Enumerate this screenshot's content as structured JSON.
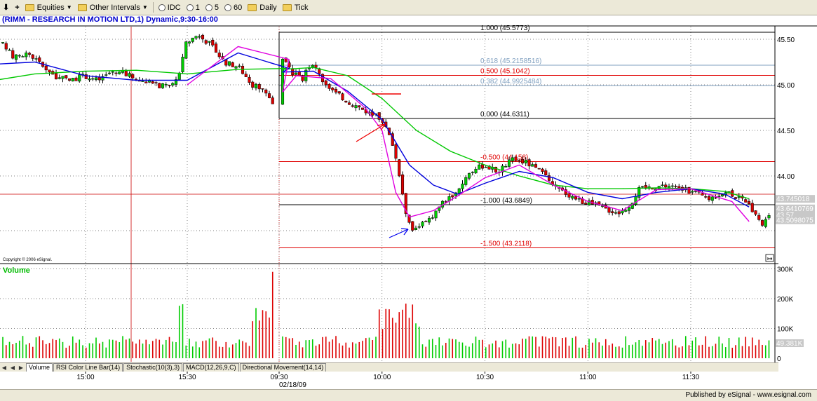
{
  "toolbar": {
    "equities_label": "Equities",
    "other_intervals_label": "Other Intervals",
    "intervals": [
      "IDC",
      "1",
      "5",
      "60",
      "Daily",
      "Tick"
    ]
  },
  "chart_header": "(RIMM - RESEARCH IN MOTION LTD,1) Dynamic,9:30-16:00",
  "copyright": "Copyright © 2006 eSignal.",
  "volume_label": "Volume",
  "footer_text": "Published by eSignal - www.esignal.com",
  "colors": {
    "up": "#00cc00",
    "down": "#dd0000",
    "ma_fast": "#e000e0",
    "ma_mid": "#0000dd",
    "ma_slow": "#00c800",
    "fib_black": "#000000",
    "fib_red": "#e00000",
    "fib_blue": "#7f9fbf",
    "grid": "#555555",
    "arrow_red": "#ee0000",
    "arrow_blue": "#0000ee"
  },
  "tabs": [
    "Volume",
    "RSI Color Line Bar(14)",
    "Stochastic(10(3),3)",
    "MACD(12,26,9,C)",
    "Directional Movement(14,14)"
  ],
  "chart_data": [
    {
      "type": "candlestick",
      "title": "(RIMM - RESEARCH IN MOTION LTD,1) Dynamic,9:30-16:00",
      "price_axis": {
        "ylim": [
          43.2,
          45.75
        ],
        "ticks": [
          45.5,
          45.0,
          44.5,
          44.0
        ],
        "tick_labels": [
          "45.50",
          "45.00",
          "44.50",
          "44.00"
        ]
      },
      "time_axis": {
        "tick_labels": [
          "15:00",
          "15:30",
          "09:30",
          "10:00",
          "10:30",
          "11:00",
          "11:30"
        ],
        "date_label": "02/18/09"
      },
      "grid": true,
      "fib_levels": [
        {
          "label": "1.000 (45.5773)",
          "value": 45.5773,
          "color": "black"
        },
        {
          "label": "0.618 (45.2158516)",
          "value": 45.2158516,
          "color": "blue"
        },
        {
          "label": "0.500 (45.1042)",
          "value": 45.1042,
          "color": "red"
        },
        {
          "label": "0.382 (44.9925484)",
          "value": 44.9925484,
          "color": "blue"
        },
        {
          "label": "0.000 (44.6311)",
          "value": 44.6311,
          "color": "black"
        },
        {
          "label": "-0.500 (44.158)",
          "value": 44.158,
          "color": "red"
        },
        {
          "label": "-1.000 (43.6849)",
          "value": 43.6849,
          "color": "black"
        },
        {
          "label": "-1.500 (43.2118)",
          "value": 43.2118,
          "color": "red"
        }
      ],
      "horizontal_line": 43.8,
      "price_labels": [
        "43.745018",
        "43.6410769",
        "43.57",
        "43.5098075"
      ],
      "ma_fast": [
        [
          "15:30",
          45.0
        ],
        [
          "15:45",
          45.42
        ],
        [
          "16:00",
          45.28
        ],
        [
          "09:31",
          44.92
        ],
        [
          "09:35",
          45.1
        ],
        [
          "09:45",
          45.07
        ],
        [
          "09:55",
          44.75
        ],
        [
          "10:00",
          44.5
        ],
        [
          "10:04",
          43.82
        ],
        [
          "10:08",
          43.55
        ],
        [
          "10:15",
          43.62
        ],
        [
          "10:22",
          43.78
        ],
        [
          "10:30",
          43.98
        ],
        [
          "10:40",
          44.12
        ],
        [
          "10:50",
          43.9
        ],
        [
          "11:00",
          43.72
        ],
        [
          "11:10",
          43.62
        ],
        [
          "11:20",
          43.85
        ],
        [
          "11:30",
          43.86
        ],
        [
          "11:35",
          43.8
        ],
        [
          "11:42",
          43.72
        ],
        [
          "11:47",
          43.5
        ]
      ],
      "ma_mid": [
        [
          "14:30",
          45.22
        ],
        [
          "14:45",
          45.25
        ],
        [
          "15:00",
          45.1
        ],
        [
          "15:15",
          45.05
        ],
        [
          "15:30",
          45.05
        ],
        [
          "15:45",
          45.35
        ],
        [
          "16:00",
          45.18
        ],
        [
          "09:31",
          45.14
        ],
        [
          "09:40",
          45.15
        ],
        [
          "09:50",
          44.93
        ],
        [
          "10:00",
          44.62
        ],
        [
          "10:08",
          44.12
        ],
        [
          "10:15",
          43.9
        ],
        [
          "10:22",
          43.8
        ],
        [
          "10:30",
          43.92
        ],
        [
          "10:40",
          44.05
        ],
        [
          "10:50",
          43.98
        ],
        [
          "11:00",
          43.82
        ],
        [
          "11:10",
          43.75
        ],
        [
          "11:20",
          43.82
        ],
        [
          "11:30",
          43.86
        ],
        [
          "11:40",
          43.8
        ],
        [
          "11:47",
          43.66
        ]
      ],
      "ma_slow": [
        [
          "14:30",
          45.03
        ],
        [
          "14:45",
          45.12
        ],
        [
          "15:00",
          45.15
        ],
        [
          "15:15",
          45.16
        ],
        [
          "15:30",
          45.12
        ],
        [
          "15:45",
          45.17
        ],
        [
          "16:00",
          45.18
        ],
        [
          "09:31",
          45.17
        ],
        [
          "09:40",
          45.19
        ],
        [
          "09:50",
          45.1
        ],
        [
          "10:00",
          44.85
        ],
        [
          "10:10",
          44.5
        ],
        [
          "10:20",
          44.27
        ],
        [
          "10:30",
          44.12
        ],
        [
          "10:40",
          44.0
        ],
        [
          "10:50",
          43.9
        ],
        [
          "11:00",
          43.86
        ],
        [
          "11:10",
          43.86
        ],
        [
          "11:20",
          43.87
        ],
        [
          "11:30",
          43.86
        ],
        [
          "11:40",
          43.83
        ],
        [
          "11:47",
          43.75
        ]
      ]
    },
    {
      "type": "bar",
      "title": "Volume",
      "ylim": [
        0,
        300000
      ],
      "ticks": [
        0,
        100000,
        200000,
        300000
      ],
      "tick_labels": [
        "0",
        "100K",
        "200K",
        "300K"
      ],
      "last_value_label": "49.381K"
    }
  ]
}
